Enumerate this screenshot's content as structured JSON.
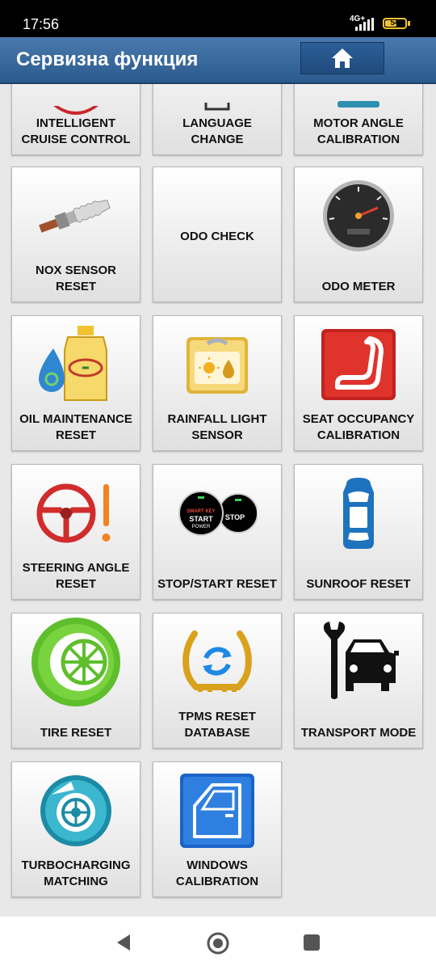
{
  "status_bar": {
    "time": "17:56",
    "network": "4G+",
    "battery": "54"
  },
  "header": {
    "title": "Сервизна функция",
    "home_icon": "home-icon"
  },
  "tiles": [
    {
      "label": "INTELLIGENT CRUISE CONTROL"
    },
    {
      "label": "LANGUAGE CHANGE"
    },
    {
      "label": "MOTOR ANGLE CALIBRATION"
    },
    {
      "label": "NOX SENSOR RESET",
      "icon": "oxygen-sensor-icon"
    },
    {
      "label": "ODO CHECK"
    },
    {
      "label": "ODO METER",
      "icon": "speedometer-icon"
    },
    {
      "label": "OIL MAINTENANCE RESET",
      "icon": "oil-bottle-icon"
    },
    {
      "label": "RAINFALL LIGHT SENSOR",
      "icon": "rain-light-sensor-icon"
    },
    {
      "label": "SEAT OCCUPANCY CALIBRATION",
      "icon": "seat-icon"
    },
    {
      "label": "STEERING ANGLE RESET",
      "icon": "steering-wheel-icon"
    },
    {
      "label": "STOP/START RESET",
      "icon": "start-stop-button-icon",
      "button_text": [
        "SMART KEY",
        "START",
        "POWER",
        "STOP"
      ]
    },
    {
      "label": "SUNROOF RESET",
      "icon": "car-top-view-icon"
    },
    {
      "label": "TIRE RESET",
      "icon": "tire-icon"
    },
    {
      "label": "TPMS RESET DATABASE",
      "icon": "tpms-icon"
    },
    {
      "label": "TRANSPORT MODE",
      "icon": "wrench-car-icon"
    },
    {
      "label": "TURBOCHARGING MATCHING",
      "icon": "turbo-icon"
    },
    {
      "label": "WINDOWS CALIBRATION",
      "icon": "car-door-icon"
    }
  ],
  "nav": {
    "back": "back-icon",
    "home": "home-circle-icon",
    "recents": "recents-icon"
  }
}
